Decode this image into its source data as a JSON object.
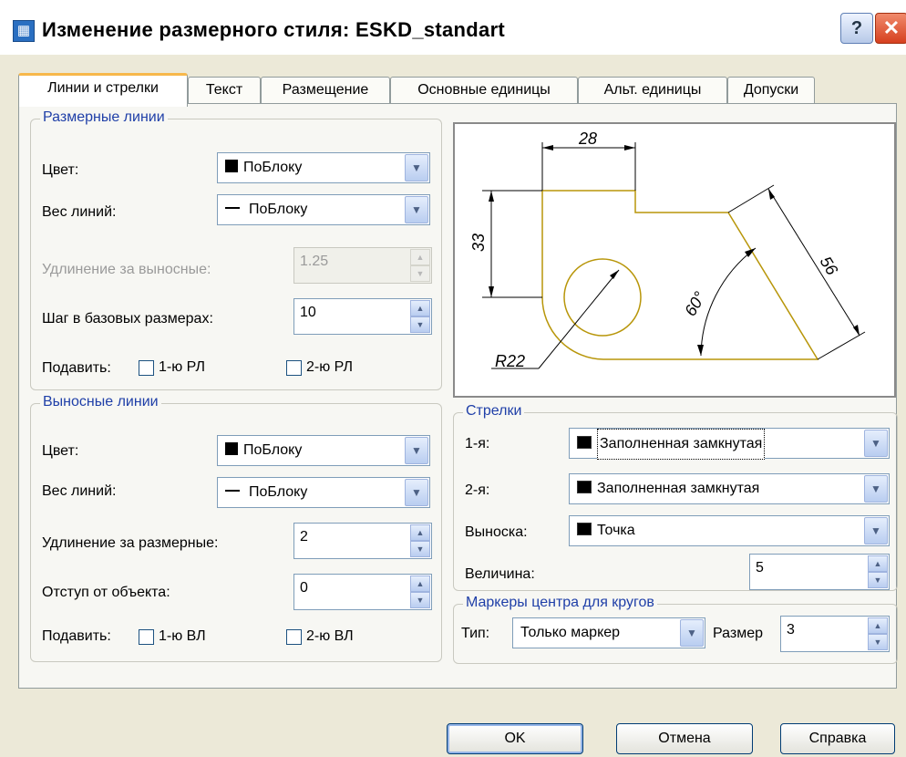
{
  "window": {
    "title": "Изменение размерного стиля: ESKD_standart"
  },
  "tabs": [
    "Линии и стрелки",
    "Текст",
    "Размещение",
    "Основные единицы",
    "Альт. единицы",
    "Допуски"
  ],
  "dim_lines": {
    "title": "Размерные линии",
    "color_label": "Цвет:",
    "color_value": "ПоБлоку",
    "weight_label": "Вес линий:",
    "weight_value": "ПоБлоку",
    "extend_label": "Удлинение за выносные:",
    "extend_value": "1.25",
    "baseline_label": "Шаг в базовых размерах:",
    "baseline_value": "10",
    "suppress_label": "Подавить:",
    "suppress_1": "1-ю РЛ",
    "suppress_2": "2-ю РЛ"
  },
  "ext_lines": {
    "title": "Выносные линии",
    "color_label": "Цвет:",
    "color_value": "ПоБлоку",
    "weight_label": "Вес линий:",
    "weight_value": "ПоБлоку",
    "extend_label": "Удлинение за размерные:",
    "extend_value": "2",
    "offset_label": "Отступ от объекта:",
    "offset_value": "0",
    "suppress_label": "Подавить:",
    "suppress_1": "1-ю ВЛ",
    "suppress_2": "2-ю ВЛ"
  },
  "preview": {
    "dim_28": "28",
    "dim_33": "33",
    "dim_56": "56",
    "dim_60": "60°",
    "dim_r22": "R22"
  },
  "arrows": {
    "title": "Стрелки",
    "first_label": "1-я:",
    "first_value": "Заполненная замкнутая",
    "second_label": "2-я:",
    "second_value": "Заполненная замкнутая",
    "leader_label": "Выноска:",
    "leader_value": "Точка",
    "size_label": "Величина:",
    "size_value": "5"
  },
  "center_marks": {
    "title": "Маркеры центра для кругов",
    "type_label": "Тип:",
    "type_value": "Только маркер",
    "size_label": "Размер",
    "size_value": "3"
  },
  "buttons": {
    "ok": "OK",
    "cancel": "Отмена",
    "help": "Справка"
  },
  "colors": {
    "accent_tab": "#f7b84b",
    "group_title": "#1f3fa8",
    "close_button": "#d6401f",
    "preview_lines": "#b8960a"
  }
}
